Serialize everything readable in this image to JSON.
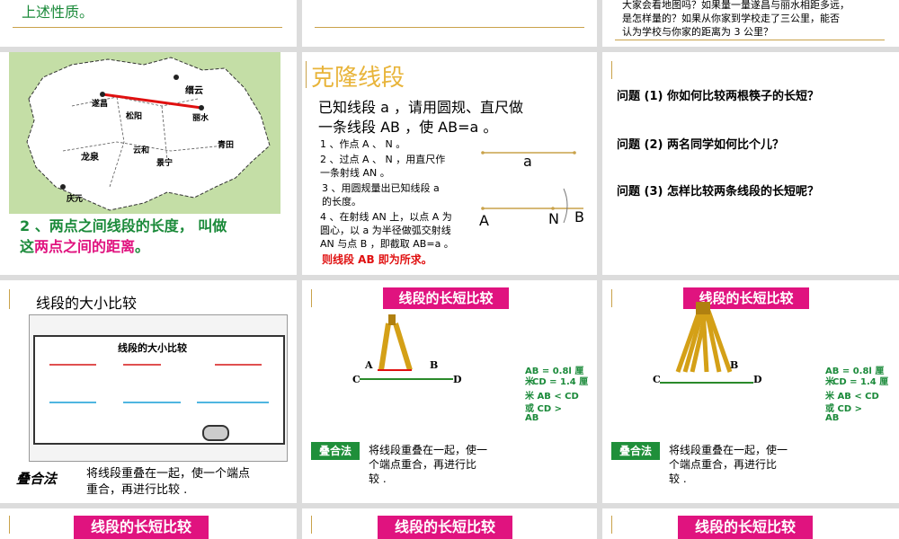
{
  "slides": {
    "s1": {
      "text": "上述性质。"
    },
    "s3": {
      "text1": "大家会看地图吗？如果量一量遂昌与丽水相距多远，",
      "text2": "是怎样量的？如果从你家到学校走了三公里，能否",
      "text3": "认为学校与你家的距离为 3 公里？"
    },
    "s4": {
      "caption1": "2 、两点之间线段的长度，  叫做",
      "caption2a": "这",
      "caption2b": "两点之间的距离",
      "caption2c": "。",
      "map_labels": [
        "遂昌",
        "松阳",
        "丽水",
        "缙云",
        "青田",
        "云和",
        "龙泉",
        "景宁",
        "庆元"
      ]
    },
    "s5": {
      "title": "克隆线段",
      "line1": "已知线段 a ，请用圆规、直尺做",
      "line2": "一条线段 AB ，使 AB=a 。",
      "step1": "1 、作点 A 、 N 。",
      "step2a": "2 、过点 A 、 N ，用直尺作",
      "step2b": "一条射线 AN 。",
      "step3a": "3 、用圆规量出已知线段 a",
      "step3b": "的长度。",
      "step4a": "4 、在射线 AN 上，以点 A 为",
      "step4b": "圆心，以 a 为半径做弧交射线",
      "step4c": "AN  与点 B ，即截取 AB=a 。",
      "result": "则线段 AB 即为所求。",
      "label_a": "a",
      "label_A": "A",
      "label_N": "N",
      "label_B": "B"
    },
    "s6": {
      "q1": "问题 (1)  你如何比较两根筷子的长短？",
      "q2": "问题 (2)  两名同学如何比个儿？",
      "q3": "问题 (3)  怎样比较两条线段的长短呢？"
    },
    "s7": {
      "title": "线段的大小比较",
      "inner_title": "线段的大小比较",
      "method_label": "叠合法",
      "method1": "将线段重叠在一起，使一个端点",
      "method2": "重合，再进行比较 ."
    },
    "s8": {
      "title": "线段的长短比较",
      "A": "A",
      "B": "B",
      "C": "C",
      "D": "D",
      "m1": "AB = 0.8l  厘",
      "m2": "米",
      "m3": "CD = 1.4  厘",
      "m4": "米  AB < CD",
      "m5": "或   CD >",
      "m6": "AB",
      "method_label": "叠合法",
      "method1": "将线段重叠在一起，使一",
      "method2": "个端点重合，再进行比",
      "method3": "较 ."
    },
    "s9": {
      "title": "线段的长短比较",
      "B": "B",
      "C": "C",
      "D": "D",
      "m1": "AB = 0.8l  厘",
      "m2": "米",
      "m3": "CD = 1.4  厘",
      "m4": "米  AB < CD",
      "m5": "或   CD >",
      "m6": "AB",
      "method_label": "叠合法",
      "method1": "将线段重叠在一起，使一",
      "method2": "个端点重合，再进行比",
      "method3": "较 ."
    },
    "s10": {
      "title": "线段的长短比较"
    },
    "s11": {
      "title": "线段的长短比较"
    },
    "s12": {
      "title": "线段的长短比较"
    }
  },
  "colors": {
    "accent": "#e0137f",
    "green": "#1f8f3a",
    "gold": "#c9a24a",
    "result_red": "#e01010"
  }
}
